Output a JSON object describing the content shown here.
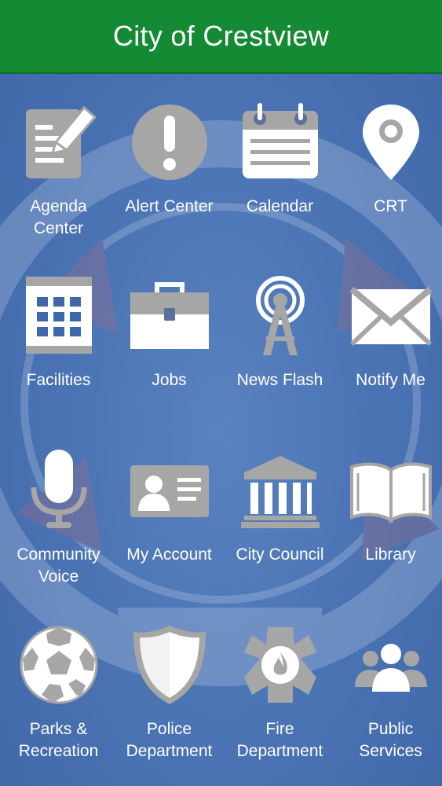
{
  "app": {
    "title": "City of Crestview"
  },
  "tiles": [
    {
      "label": "Agenda\nCenter",
      "icon": "agenda-icon"
    },
    {
      "label": "Alert Center",
      "icon": "alert-icon"
    },
    {
      "label": "Calendar",
      "icon": "calendar-icon"
    },
    {
      "label": "CRT",
      "icon": "map-pin-icon"
    },
    {
      "label": "Facilities",
      "icon": "building-icon"
    },
    {
      "label": "Jobs",
      "icon": "briefcase-icon"
    },
    {
      "label": "News Flash",
      "icon": "broadcast-tower-icon"
    },
    {
      "label": "Notify Me",
      "icon": "envelope-icon"
    },
    {
      "label": "Community\nVoice",
      "icon": "microphone-icon"
    },
    {
      "label": "My Account",
      "icon": "id-card-icon"
    },
    {
      "label": "City Council",
      "icon": "government-building-icon"
    },
    {
      "label": "Library",
      "icon": "open-book-icon"
    },
    {
      "label": "Parks &\nRecreation",
      "icon": "soccer-ball-icon"
    },
    {
      "label": "Police\nDepartment",
      "icon": "shield-icon"
    },
    {
      "label": "Fire\nDepartment",
      "icon": "fire-emblem-icon"
    },
    {
      "label": "Public\nServices",
      "icon": "people-icon"
    }
  ],
  "colors": {
    "header_green": "#138a33",
    "background_blue": "#4a73b4",
    "icon_gray": "#a6a6a6",
    "icon_white": "#ffffff"
  }
}
